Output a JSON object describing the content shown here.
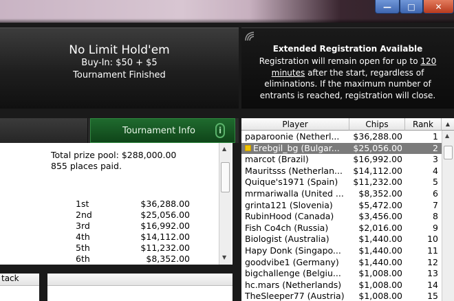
{
  "window": {
    "minimize_label": "—",
    "maximize_label": "□",
    "close_label": "✕"
  },
  "header": {
    "title": "No Limit Hold'em",
    "buyin": "Buy-In: $50 + $5",
    "status": "Tournament Finished"
  },
  "notice": {
    "heading": "Extended Registration Available",
    "line1_pre": "Registration will remain open for up to ",
    "line1_link": "120",
    "line2_link": "minutes",
    "line2_post": " after the start, regardless of",
    "line3": "eliminations. If the maximum number of",
    "line4": "entrants is reached, registration will close."
  },
  "tabs": {
    "info_label": "Tournament Info",
    "info_icon": "i"
  },
  "prizes": {
    "total": "Total prize pool: $288,000.00",
    "paid": "855 places paid.",
    "rows": [
      {
        "place": "1st",
        "amount": "$36,288.00"
      },
      {
        "place": "2nd",
        "amount": "$25,056.00"
      },
      {
        "place": "3rd",
        "amount": "$16,992.00"
      },
      {
        "place": "4th",
        "amount": "$14,112.00"
      },
      {
        "place": "5th",
        "amount": "$11,232.00"
      },
      {
        "place": "6th",
        "amount": "$8,352.00"
      }
    ]
  },
  "bottom": {
    "stack_header": "tack"
  },
  "players": {
    "headers": {
      "player": "Player",
      "chips": "Chips",
      "rank": "Rank"
    },
    "selected_index": 1,
    "rows": [
      {
        "name": "paparoonie (Netherl...",
        "chips": "$36,288.00",
        "rank": "1"
      },
      {
        "name": "Erebgil_bg (Bulgar...",
        "chips": "$25,056.00",
        "rank": "2"
      },
      {
        "name": "marcot (Brazil)",
        "chips": "$16,992.00",
        "rank": "3"
      },
      {
        "name": "Mauritsss (Netherlan...",
        "chips": "$14,112.00",
        "rank": "4"
      },
      {
        "name": "Quique's1971 (Spain)",
        "chips": "$11,232.00",
        "rank": "5"
      },
      {
        "name": "mrmariwalla (United ...",
        "chips": "$8,352.00",
        "rank": "6"
      },
      {
        "name": "grinta121 (Slovenia)",
        "chips": "$5,472.00",
        "rank": "7"
      },
      {
        "name": "RubinHood (Canada)",
        "chips": "$3,456.00",
        "rank": "8"
      },
      {
        "name": "Fish Co4ch (Russia)",
        "chips": "$2,016.00",
        "rank": "9"
      },
      {
        "name": "Biologist (Australia)",
        "chips": "$1,440.00",
        "rank": "10"
      },
      {
        "name": "Hapy Donk (Singapo...",
        "chips": "$1,440.00",
        "rank": "11"
      },
      {
        "name": "goodvibe1 (Germany)",
        "chips": "$1,440.00",
        "rank": "12"
      },
      {
        "name": "bigchallenge (Belgiu...",
        "chips": "$1,008.00",
        "rank": "13"
      },
      {
        "name": "hc.mars (Netherlands)",
        "chips": "$1,008.00",
        "rank": "14"
      },
      {
        "name": "TheSleeper77 (Austria)",
        "chips": "$1,008.00",
        "rank": "15"
      }
    ]
  }
}
